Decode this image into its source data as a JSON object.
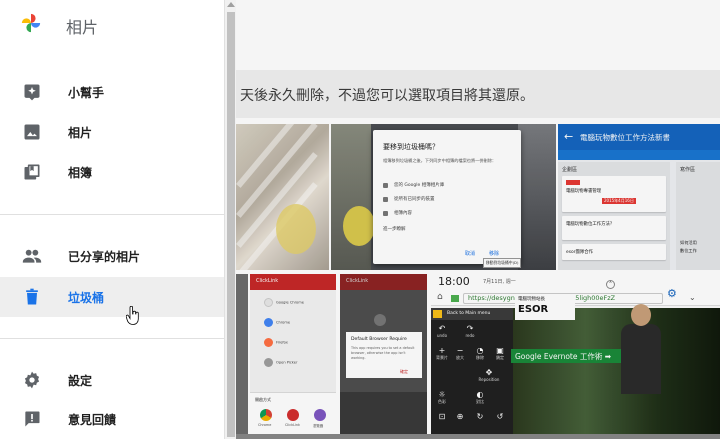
{
  "app": {
    "title": "相片"
  },
  "banner": {
    "text": "天後永久刪除，不過您可以選取項目將其還原。"
  },
  "nav": {
    "items": [
      {
        "label": "小幫手",
        "icon": "assistant-icon"
      },
      {
        "label": "相片",
        "icon": "photo-icon"
      },
      {
        "label": "相簿",
        "icon": "albums-icon"
      },
      {
        "label": "已分享的相片",
        "icon": "people-icon"
      },
      {
        "label": "垃圾桶",
        "icon": "trash-icon",
        "active": true
      },
      {
        "label": "設定",
        "icon": "gear-icon"
      },
      {
        "label": "意見回饋",
        "icon": "feedback-icon"
      }
    ]
  },
  "tiles": {
    "dialog": {
      "title": "要移到垃圾桶嗎？",
      "body": "相簿移到垃圾桶之後，下列同步中相簿的檔案也將一併刪除：",
      "items": [
        "您的 Google 相簿相片庫",
        "從所有已同步的裝置",
        "相簿內容"
      ],
      "more": "進一步瞭解",
      "cancel": "取消",
      "confirm": "移除",
      "tooltip": "移動到垃圾桶中(D)"
    },
    "board": {
      "title": "電腦玩物數位工作方法新書",
      "col1": "企劃區",
      "col2": "寫作區",
      "cards": [
        "電腦玩物專書管理",
        "電腦玩物數位工作方法？",
        "esor團隊合作"
      ],
      "date": "2015年4月16日",
      "side": [
        "如何活用",
        "數位工作"
      ]
    },
    "phone1": {
      "title": "ClickLink",
      "rows": [
        "Google Chrome",
        "Chrome",
        "Firefox",
        "Open Picker"
      ],
      "footer": "開啟方式",
      "apps": [
        "Chrome",
        "ClickLink",
        "瀏覽器"
      ]
    },
    "phone2": {
      "title": "ClickLink",
      "dialog_title": "Default Browser Require",
      "dialog_body": "This app requires you to set a default browser, otherwise the app isn't working.",
      "ok": "確定"
    },
    "editor": {
      "time": "18:00",
      "date": "7月11日, 週一",
      "url": "https://desygner.com/editor/?id=5ligh00eFzZ",
      "panel_title": "Back to Main menu",
      "panel_buttons": [
        "undo",
        "redo",
        "背景片",
        "放大",
        "移除",
        "鎖定",
        "Reposition",
        "色彩",
        "對比"
      ],
      "slide_sub": "電腦玩物站長",
      "slide_big": "ESOR",
      "slide_green": "Google Evernote 工作術 ➡"
    }
  }
}
